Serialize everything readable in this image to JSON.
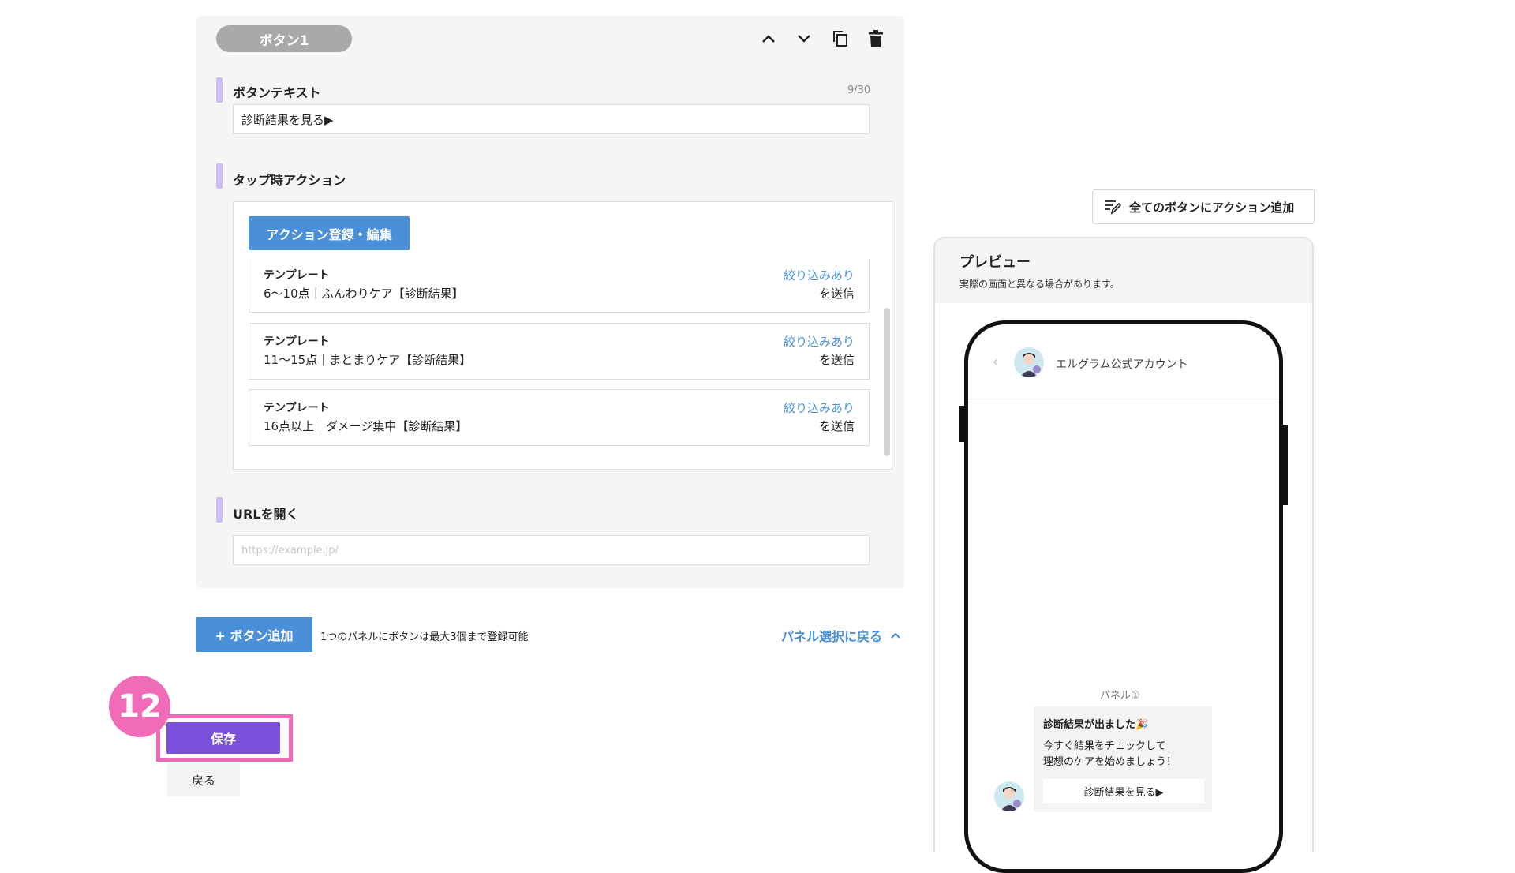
{
  "editor": {
    "button_pill": "ボタン1",
    "button_text_section": {
      "title": "ボタンテキスト",
      "counter": "9/30",
      "value": "診断結果を見る▶"
    },
    "tap_action_section": {
      "title": "タップ時アクション",
      "action_button": "アクション登録・編集",
      "cards": [
        {
          "type": "テンプレート",
          "name": "6〜10点｜ふんわりケア【診断結果】",
          "filter": "絞り込みあり",
          "send": "を送信"
        },
        {
          "type": "テンプレート",
          "name": "11〜15点｜まとまりケア【診断結果】",
          "filter": "絞り込みあり",
          "send": "を送信"
        },
        {
          "type": "テンプレート",
          "name": "16点以上｜ダメージ集中【診断結果】",
          "filter": "絞り込みあり",
          "send": "を送信"
        }
      ]
    },
    "url_section": {
      "title": "URLを開く",
      "placeholder": "https://example.jp/"
    }
  },
  "footer": {
    "add_button": "+ ボタン追加",
    "add_note": "1つのパネルにボタンは最大3個まで登録可能",
    "back_to_panel": "パネル選択に戻る",
    "step_number": "12",
    "save": "保存",
    "back": "戻る"
  },
  "right": {
    "all_actions_button": "全てのボタンにアクション追加",
    "preview_title": "プレビュー",
    "preview_sub": "実際の画面と異なる場合があります。",
    "account_name": "エルグラム公式アカウント",
    "panel_label": "パネル①",
    "message_title": "診断結果が出ました🎉",
    "message_body": "今すぐ結果をチェックして\n理想のケアを始めましょう！",
    "message_button": "診断結果を見る▶"
  },
  "colors": {
    "accent_blue": "#4a90d9",
    "save_purple": "#7a4fdc",
    "step_pink": "#f06bb8",
    "section_bar": "#cbbdf0"
  }
}
